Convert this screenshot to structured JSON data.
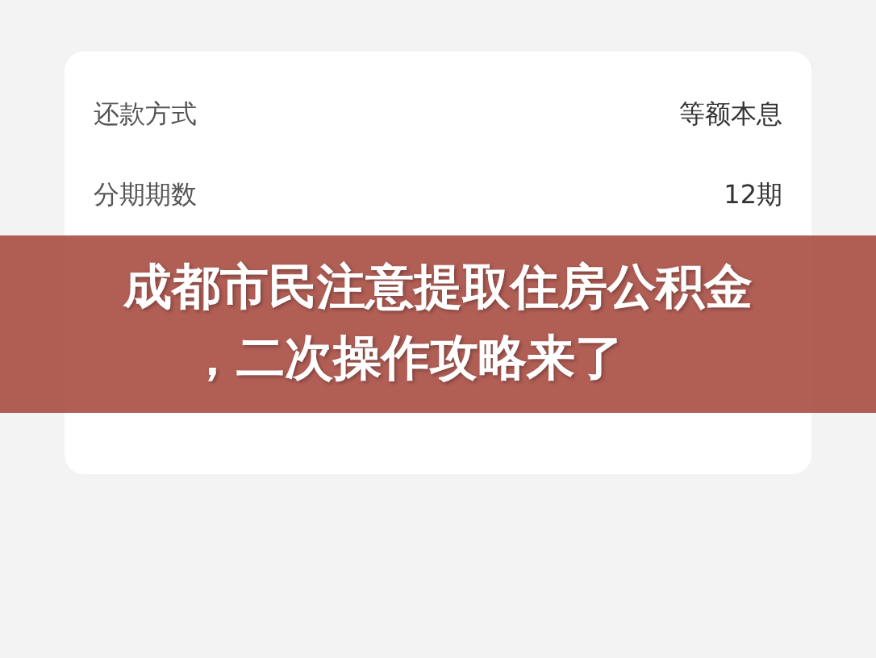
{
  "details": [
    {
      "label": "还款方式",
      "value": "等额本息"
    },
    {
      "label": "分期期数",
      "value": "12期"
    }
  ],
  "headline": [
    "成都市民注意提取住房公积金",
    "，二次操作攻略来了"
  ]
}
